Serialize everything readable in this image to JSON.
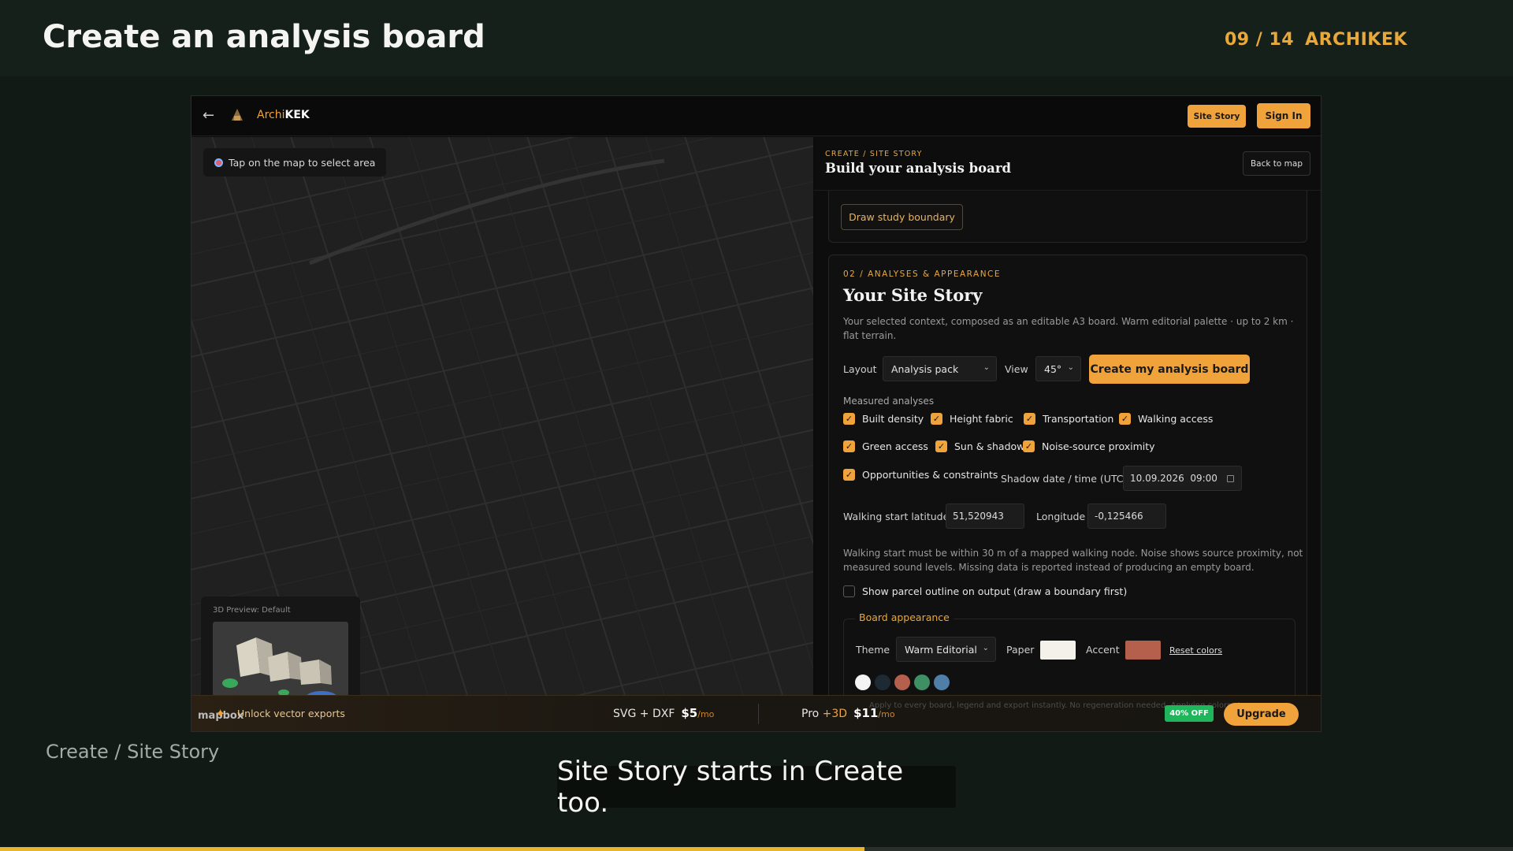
{
  "slide": {
    "title": "Create an analysis board",
    "counter": "09 / 14",
    "brand": "ARCHIKEK",
    "subtitle": "Create / Site Story",
    "caption": "Site Story starts in Create too.",
    "progress": 0.5714
  },
  "app": {
    "logo_prefix": "Archi",
    "logo_suffix": "KEK",
    "top_buttons": {
      "site_story": "Site Story",
      "sign_in": "Sign In"
    },
    "map": {
      "hint": "Tap on the map to select area",
      "preview_label": "3D Preview: Default",
      "attribution": "mapbox"
    },
    "panel": {
      "breadcrumb": "CREATE / SITE STORY",
      "title": "Build your analysis board",
      "back_to_map": "Back to map",
      "draw_boundary": "Draw study boundary",
      "section_label": "02 / ANALYSES & APPEARANCE",
      "section_title": "Your Site Story",
      "section_desc": "Your selected context, composed as an editable A3 board. Warm editorial palette · up to 2 km · flat terrain.",
      "layout_label": "Layout",
      "layout_value": "Analysis pack",
      "view_label": "View",
      "view_value": "45°",
      "create_button": "Create my analysis board",
      "measured_label": "Measured analyses",
      "analyses": [
        {
          "label": "Built density",
          "checked": true
        },
        {
          "label": "Height fabric",
          "checked": true
        },
        {
          "label": "Transportation",
          "checked": true
        },
        {
          "label": "Walking access",
          "checked": true
        },
        {
          "label": "Green access",
          "checked": true
        },
        {
          "label": "Sun & shadow",
          "checked": true
        },
        {
          "label": "Noise-source proximity",
          "checked": true
        },
        {
          "label": "Opportunities & constraints",
          "checked": true
        }
      ],
      "shadow_label": "Shadow date / time (UTC)",
      "shadow_value": "10.09.2026  09:00",
      "lat_label": "Walking start latitude",
      "lat_value": "51,520943",
      "lon_label": "Longitude",
      "lon_value": "-0,125466",
      "note": "Walking start must be within 30 m of a mapped walking node. Noise shows source proximity, not measured sound levels. Missing data is reported instead of producing an empty board.",
      "parcel_label": "Show parcel outline on output (draw a boundary first)",
      "parcel_checked": false,
      "board_appearance": "Board appearance",
      "theme_label": "Theme",
      "theme_value": "Warm Editorial",
      "paper_label": "Paper",
      "paper_color": "#f4f1ea",
      "accent_label": "Accent",
      "accent_color": "#b4604d",
      "reset_colors": "Reset colors",
      "palette": [
        "#f4f4f4",
        "#1e2a33",
        "#b4604d",
        "#3f8f64",
        "#4f7fa9"
      ]
    },
    "upsell": {
      "unlock": "Unlock vector exports",
      "svg_dxf": "SVG + DXF",
      "svg_price": "$5",
      "per_mo": "/mo",
      "pro": "Pro",
      "pro_plus": "+3D",
      "pro_price": "$11",
      "faded_text": "Apply to every board, legend and export instantly. No regeneration needed. Applying colors st",
      "discount": "40% OFF",
      "upgrade": "Upgrade"
    }
  },
  "colors": {
    "accent": "#f0a33a",
    "slide_bg": "#111a15"
  }
}
